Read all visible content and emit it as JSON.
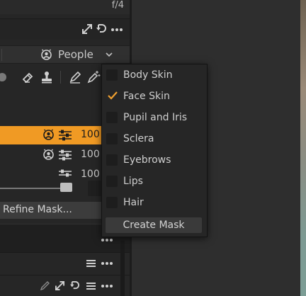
{
  "window": {
    "aperture": "f/4"
  },
  "mask_selector": {
    "selected": "People",
    "options": [
      {
        "label": "Body Skin",
        "checked": false
      },
      {
        "label": "Face Skin",
        "checked": true
      },
      {
        "label": "Pupil and Iris",
        "checked": false
      },
      {
        "label": "Sclera",
        "checked": false
      },
      {
        "label": "Eyebrows",
        "checked": false
      },
      {
        "label": "Lips",
        "checked": false
      },
      {
        "label": "Hair",
        "checked": false
      }
    ],
    "create_label": "Create Mask"
  },
  "layers": [
    {
      "opacity": "100",
      "selected": true
    },
    {
      "opacity": "100",
      "selected": false
    },
    {
      "opacity": "100",
      "selected": false
    }
  ],
  "refine_label": "Refine Mask...",
  "colors": {
    "accent": "#f09a24",
    "check": "#f0a030"
  },
  "icons": [
    "expand-icon",
    "undo-icon",
    "more-icon",
    "people-icon",
    "chevron-down-icon",
    "eraser-icon",
    "stamp-icon",
    "pen-icon",
    "magic-pen-icon",
    "adjust-icon",
    "list-icon",
    "edit-icon"
  ]
}
